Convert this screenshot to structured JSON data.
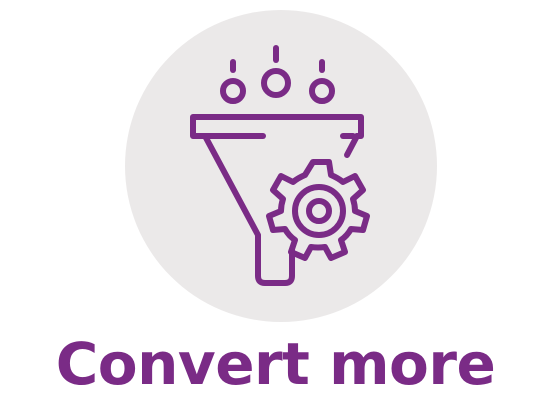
{
  "caption": "Convert more",
  "colors": {
    "accent": "#7a2b86",
    "circle_background": "#ebe9e9",
    "page_background": "#ffffff"
  },
  "icons": {
    "main": "funnel-gear-icon"
  }
}
